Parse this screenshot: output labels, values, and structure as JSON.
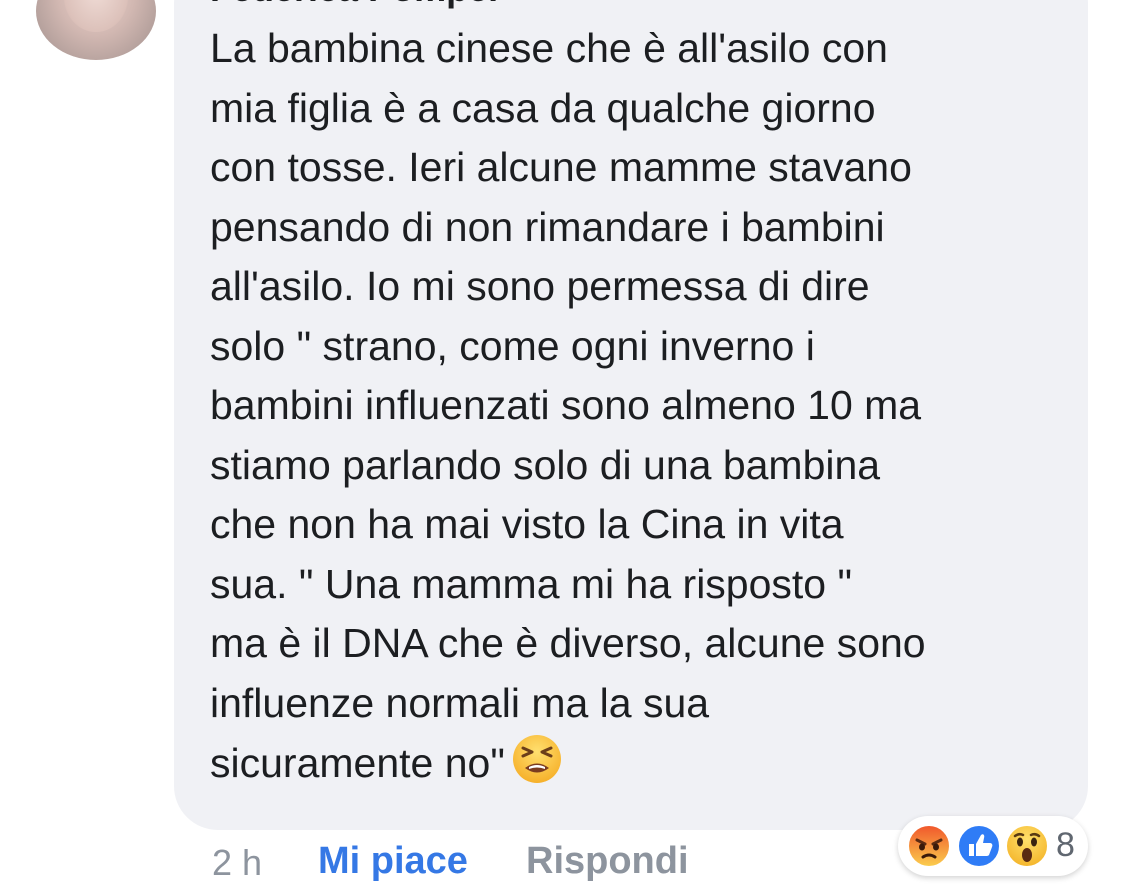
{
  "comment": {
    "author": "Federica Pompei",
    "text": "La bambina cinese che è all'asilo con\nmia figlia è a casa da qualche giorno\ncon tosse. Ieri alcune mamme stavano\npensando di non rimandare i bambini\nall'asilo. Io mi sono permessa di dire\nsolo \" strano, come ogni inverno i\nbambini influenzati sono almeno 10 ma\nstiamo parlando solo di una bambina\nche non ha mai visto la Cina in vita\nsua. \"  Una mamma mi ha risposto \"\nma è il DNA che è diverso, alcune sono\ninfluenze normali ma la sua\n",
    "last_line": "sicuramente no\"",
    "emoji": "tired-face-emoji"
  },
  "meta": {
    "time": "2 h",
    "like_label": "Mi piace",
    "reply_label": "Rispondi"
  },
  "reactions": {
    "icons": [
      "angry-reaction-icon",
      "like-reaction-icon",
      "wow-reaction-icon"
    ],
    "count": "8"
  },
  "colors": {
    "bubble": "#f0f1f5",
    "text": "#1c1e21",
    "like_blue": "#3578e5",
    "muted": "#8d949e"
  }
}
